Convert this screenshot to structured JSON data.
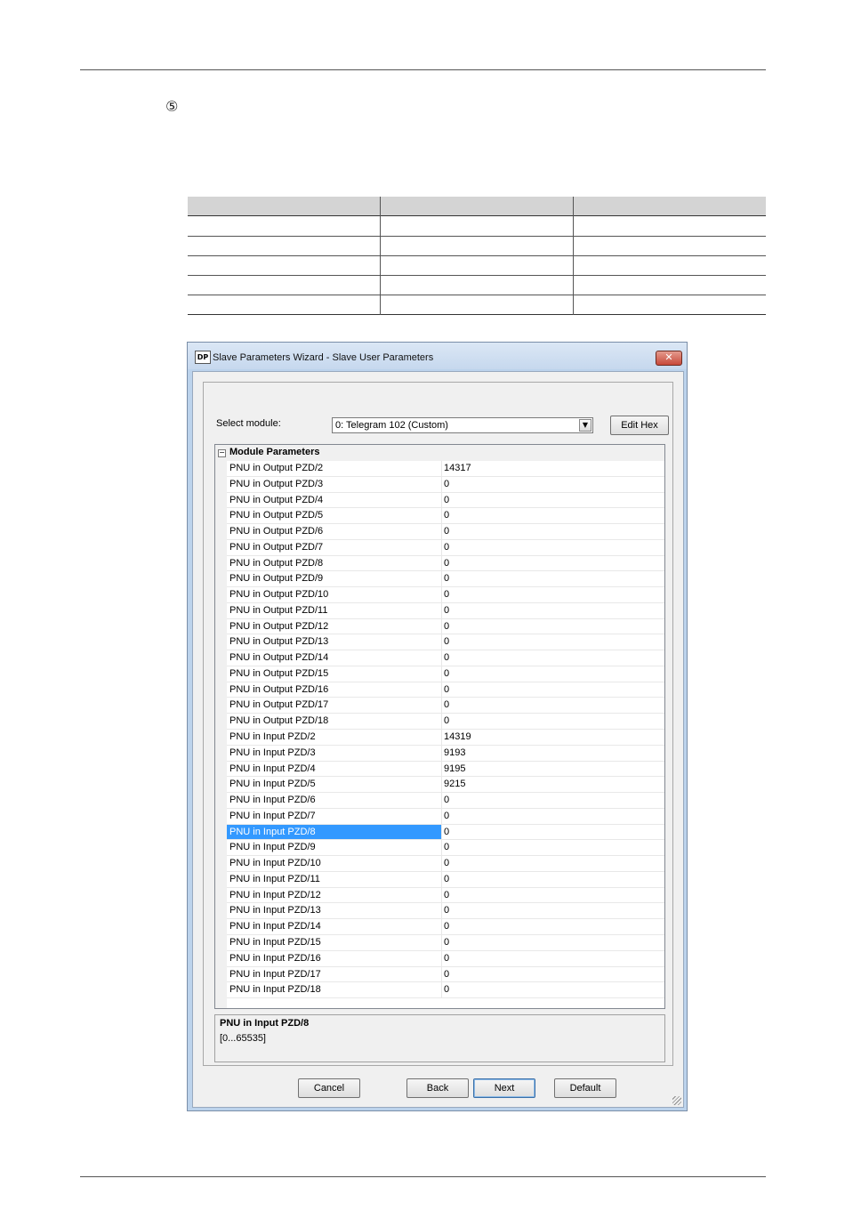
{
  "step_marker": "⑤",
  "dialog": {
    "icon_text": "DP",
    "title": "Slave Parameters Wizard - Slave User Parameters",
    "close_symbol": "✕",
    "select_label": "Select module:",
    "select_value": "0: Telegram 102 (Custom)",
    "edit_hex": "Edit Hex",
    "grid_header": "Module Parameters",
    "rows": [
      {
        "name": "PNU in Output PZD/2",
        "value": "14317"
      },
      {
        "name": "PNU in Output PZD/3",
        "value": "0"
      },
      {
        "name": "PNU in Output PZD/4",
        "value": "0"
      },
      {
        "name": "PNU in Output PZD/5",
        "value": "0"
      },
      {
        "name": "PNU in Output PZD/6",
        "value": "0"
      },
      {
        "name": "PNU in Output PZD/7",
        "value": "0"
      },
      {
        "name": "PNU in Output PZD/8",
        "value": "0"
      },
      {
        "name": "PNU in Output PZD/9",
        "value": "0"
      },
      {
        "name": "PNU in Output PZD/10",
        "value": "0"
      },
      {
        "name": "PNU in Output PZD/11",
        "value": "0"
      },
      {
        "name": "PNU in Output PZD/12",
        "value": "0"
      },
      {
        "name": "PNU in Output PZD/13",
        "value": "0"
      },
      {
        "name": "PNU in Output PZD/14",
        "value": "0"
      },
      {
        "name": "PNU in Output PZD/15",
        "value": "0"
      },
      {
        "name": "PNU in Output PZD/16",
        "value": "0"
      },
      {
        "name": "PNU in Output PZD/17",
        "value": "0"
      },
      {
        "name": "PNU in Output PZD/18",
        "value": "0"
      },
      {
        "name": "PNU in Input PZD/2",
        "value": "14319"
      },
      {
        "name": "PNU in Input PZD/3",
        "value": "9193"
      },
      {
        "name": "PNU in Input PZD/4",
        "value": "9195"
      },
      {
        "name": "PNU in Input PZD/5",
        "value": "9215"
      },
      {
        "name": "PNU in Input PZD/6",
        "value": "0"
      },
      {
        "name": "PNU in Input PZD/7",
        "value": "0"
      },
      {
        "name": "PNU in Input PZD/8",
        "value": "0",
        "selected": true
      },
      {
        "name": "PNU in Input PZD/9",
        "value": "0"
      },
      {
        "name": "PNU in Input PZD/10",
        "value": "0"
      },
      {
        "name": "PNU in Input PZD/11",
        "value": "0"
      },
      {
        "name": "PNU in Input PZD/12",
        "value": "0"
      },
      {
        "name": "PNU in Input PZD/13",
        "value": "0"
      },
      {
        "name": "PNU in Input PZD/14",
        "value": "0"
      },
      {
        "name": "PNU in Input PZD/15",
        "value": "0"
      },
      {
        "name": "PNU in Input PZD/16",
        "value": "0"
      },
      {
        "name": "PNU in Input PZD/17",
        "value": "0"
      },
      {
        "name": "PNU in Input PZD/18",
        "value": "0"
      }
    ],
    "description": {
      "title": "PNU in Input PZD/8",
      "range": "[0...65535]"
    },
    "buttons": {
      "cancel": "Cancel",
      "back": "Back",
      "next": "Next",
      "default": "Default"
    },
    "selection_color": "#3399ff"
  }
}
